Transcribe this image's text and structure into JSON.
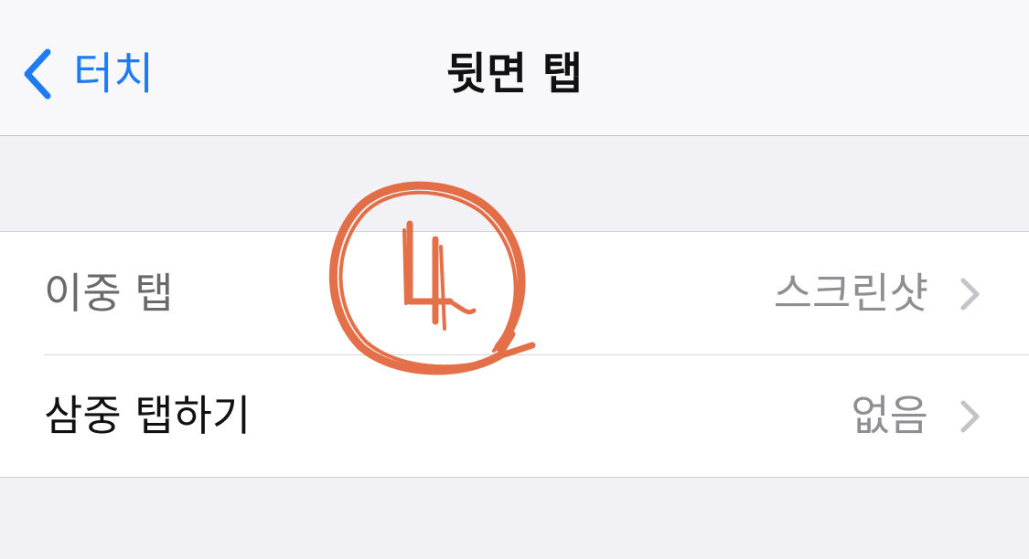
{
  "navbar": {
    "back_label": "터치",
    "title": "뒷면 탭"
  },
  "settings": {
    "rows": [
      {
        "label": "이중 탭",
        "value": "스크린샷"
      },
      {
        "label": "삼중 탭하기",
        "value": "없음"
      }
    ]
  },
  "colors": {
    "accent": "#1d7cf2",
    "highlight": "#f7a07a",
    "annotation": "#e0582a",
    "background": "#f2f2f6"
  },
  "icons": {
    "back": "chevron-left-icon",
    "disclosure": "chevron-right-icon"
  }
}
